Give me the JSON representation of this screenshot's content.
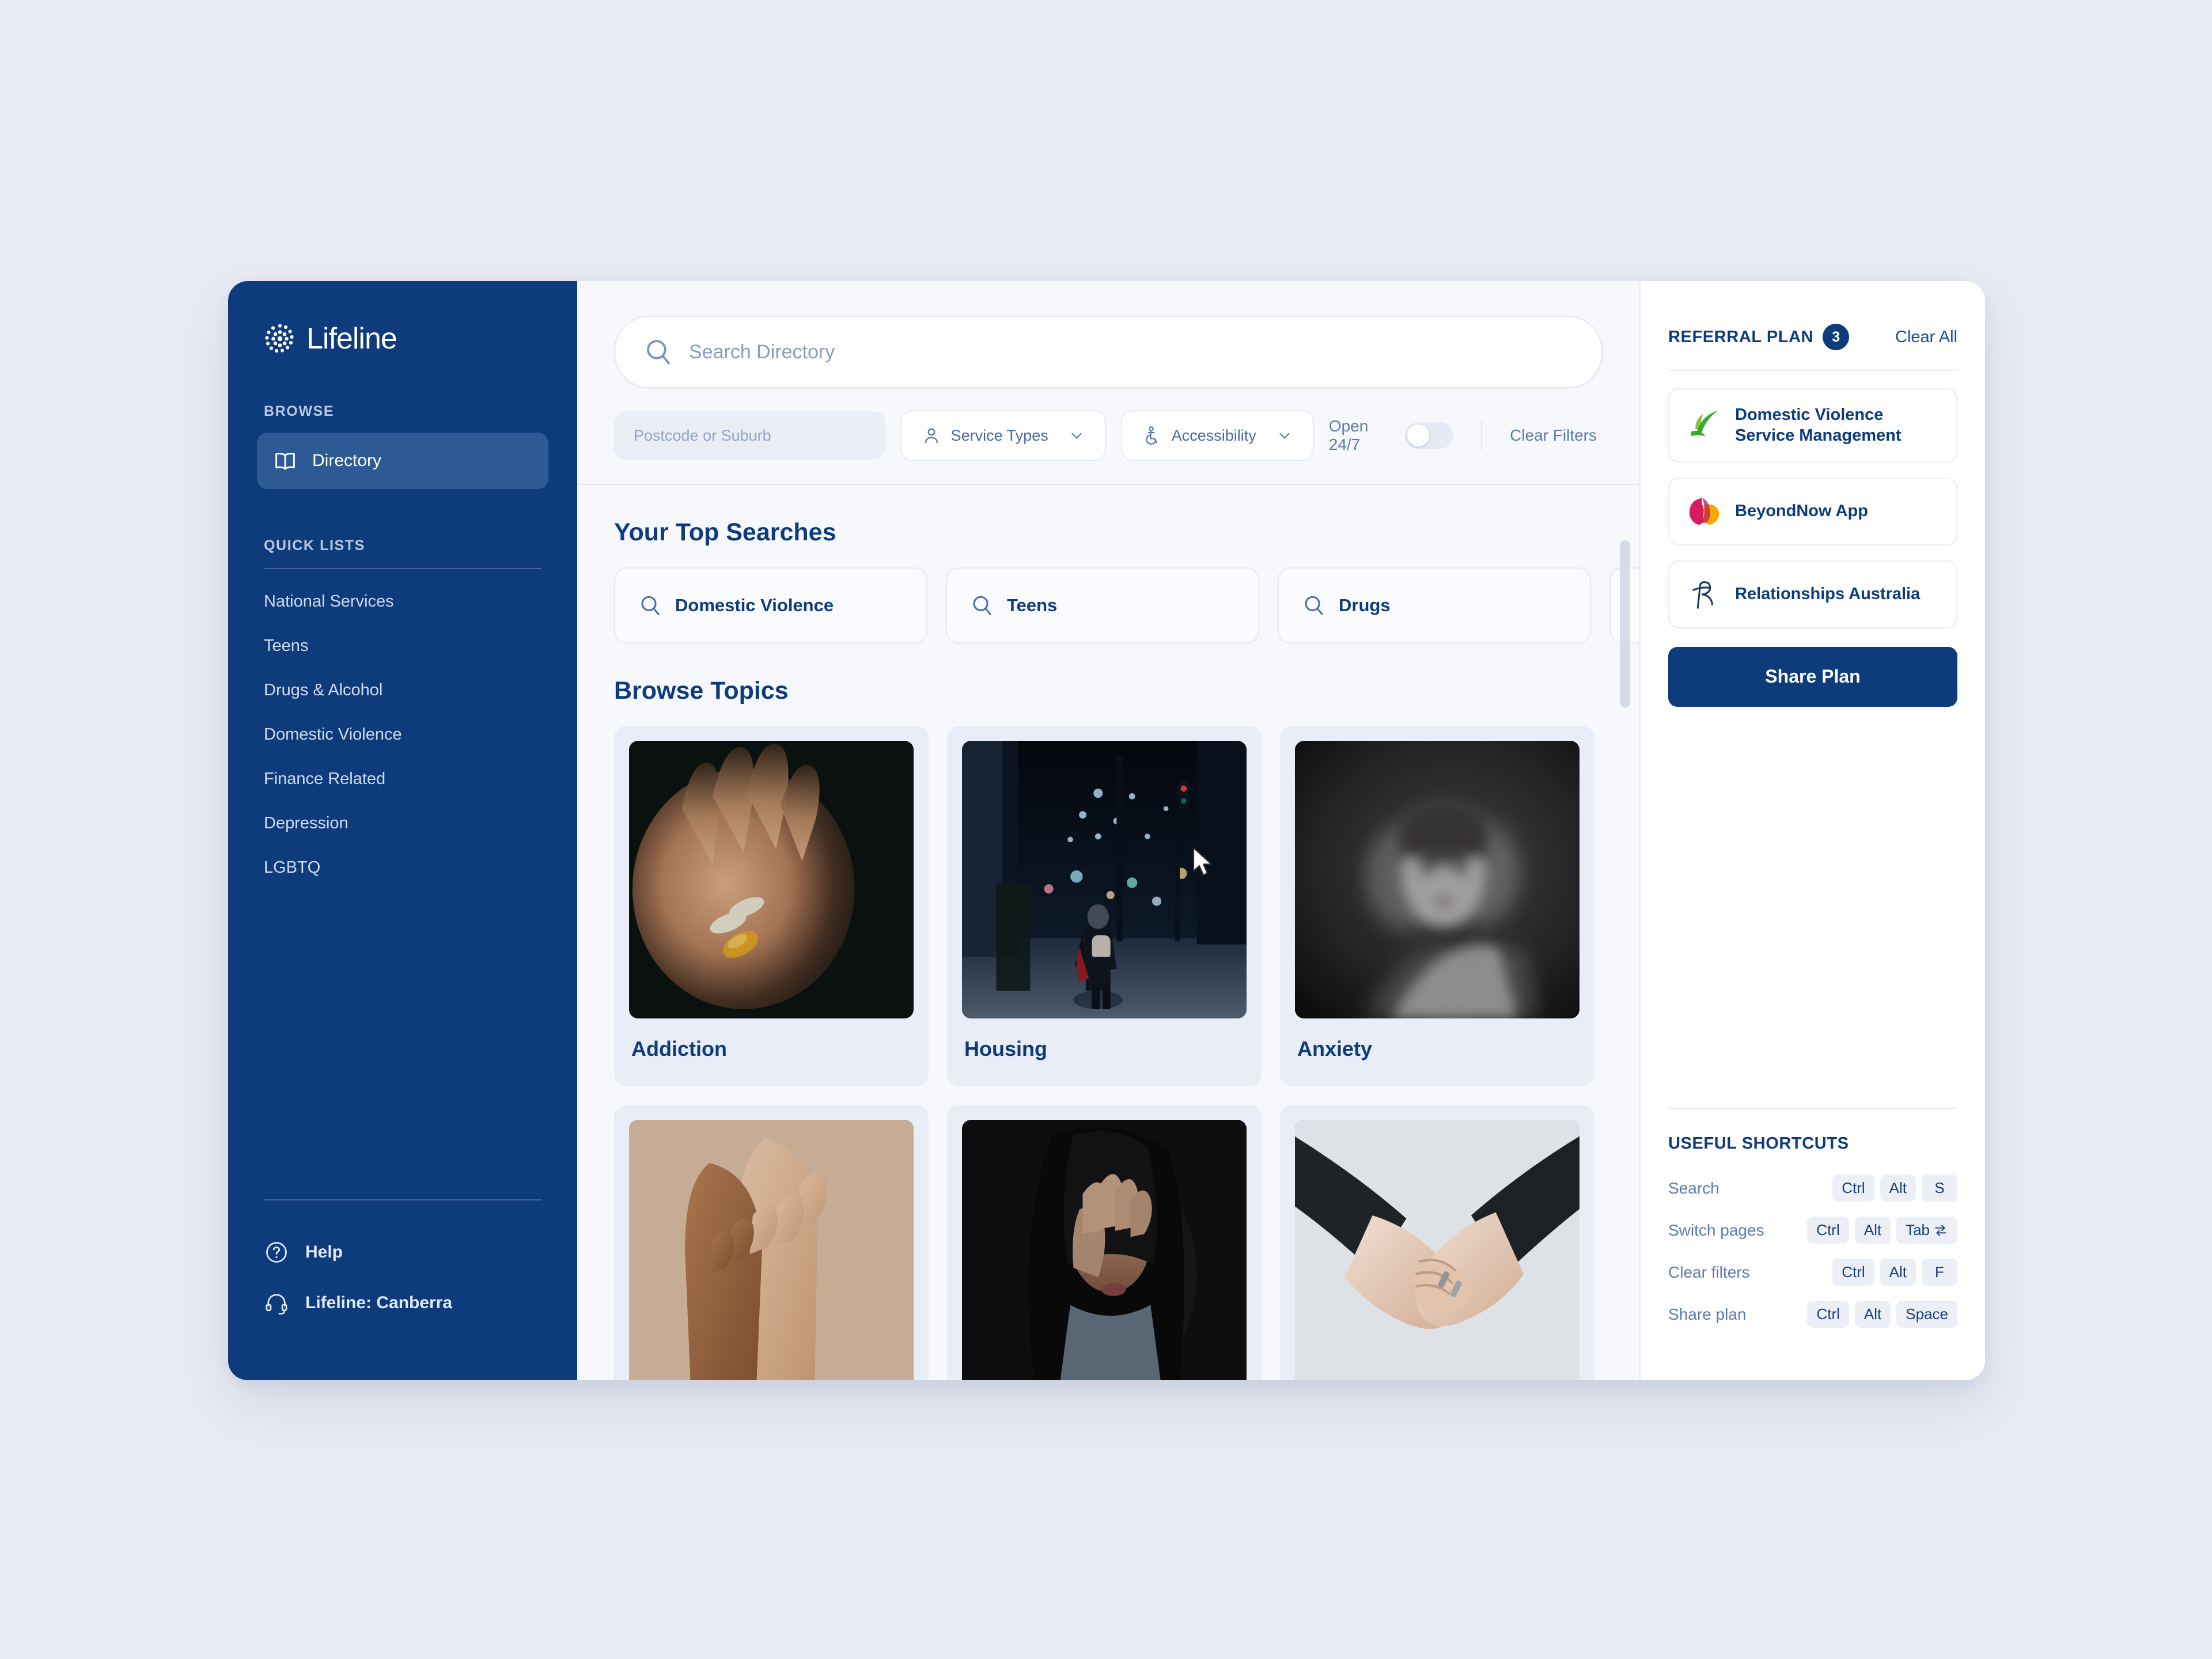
{
  "brand": {
    "name": "Lifeline"
  },
  "sidebar": {
    "browse_label": "BROWSE",
    "nav": [
      {
        "label": "Directory",
        "icon": "book-icon",
        "active": true
      }
    ],
    "quick_lists_label": "QUICK LISTS",
    "quick_lists": [
      {
        "label": "National Services"
      },
      {
        "label": "Teens"
      },
      {
        "label": "Drugs & Alcohol"
      },
      {
        "label": "Domestic Violence"
      },
      {
        "label": "Finance Related"
      },
      {
        "label": "Depression"
      },
      {
        "label": "LGBTQ"
      }
    ],
    "footer": [
      {
        "label": "Help",
        "icon": "question-circle-icon"
      },
      {
        "label": "Lifeline:  Canberra",
        "icon": "headset-icon"
      }
    ]
  },
  "search": {
    "placeholder": "Search Directory",
    "icon": "search-icon"
  },
  "filters": {
    "postcode_placeholder": "Postcode or Suburb",
    "service_types_label": "Service Types",
    "accessibility_label": "Accessibility",
    "open_247_label": "Open 24/7",
    "open_247_on": false,
    "clear_filters_label": "Clear Filters"
  },
  "top_searches": {
    "title": "Your Top Searches",
    "items": [
      {
        "label": "Domestic Violence"
      },
      {
        "label": "Teens"
      },
      {
        "label": "Drugs"
      },
      {
        "label": ""
      }
    ]
  },
  "browse_topics": {
    "title": "Browse Topics",
    "items": [
      {
        "label": "Addiction",
        "image": "hand-holding-pills"
      },
      {
        "label": "Housing",
        "image": "person-walking-night-street"
      },
      {
        "label": "Anxiety",
        "image": "blurred-portrait-woman"
      },
      {
        "label": "",
        "image": "two-hands-clasped"
      },
      {
        "label": "",
        "image": "woman-covering-face"
      },
      {
        "label": "",
        "image": "hands-reaching-holding"
      }
    ]
  },
  "referral_plan": {
    "title": "REFERRAL PLAN",
    "count": "3",
    "clear_all_label": "Clear All",
    "items": [
      {
        "name": "Domestic Violence Service Management",
        "logo": "green-leaf-tick-logo"
      },
      {
        "name": "BeyondNow App",
        "logo": "pink-yellow-butterfly-logo"
      },
      {
        "name": "Relationships Australia",
        "logo": "script-r-logo"
      }
    ],
    "share_button_label": "Share Plan"
  },
  "shortcuts": {
    "title": "USEFUL SHORTCUTS",
    "rows": [
      {
        "label": "Search",
        "keys": [
          "Ctrl",
          "Alt",
          "S"
        ]
      },
      {
        "label": "Switch pages",
        "keys": [
          "Ctrl",
          "Alt",
          "Tab"
        ]
      },
      {
        "label": "Clear filters",
        "keys": [
          "Ctrl",
          "Alt",
          "F"
        ]
      },
      {
        "label": "Share plan",
        "keys": [
          "Ctrl",
          "Alt",
          "Space"
        ]
      }
    ]
  },
  "colors": {
    "brand_navy": "#0d3b7c",
    "page_bg": "#e8eaf4",
    "panel_bg": "#f6f8fc",
    "accent_active": "#2d5a95"
  }
}
